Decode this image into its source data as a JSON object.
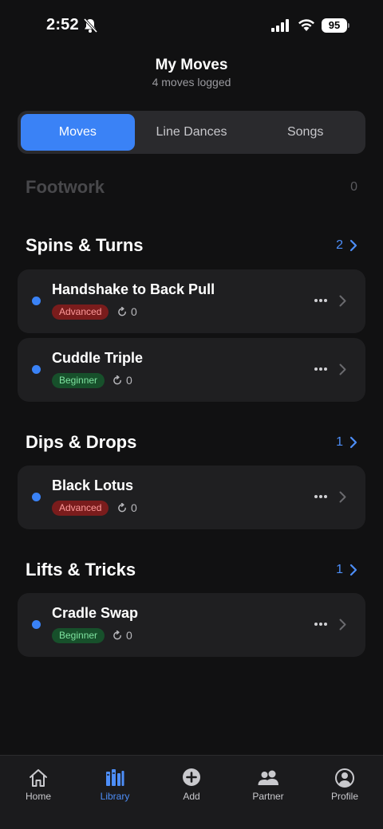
{
  "status_bar": {
    "time": "2:52",
    "battery": "95"
  },
  "header": {
    "title": "My Moves",
    "subtitle": "4 moves logged"
  },
  "segments": [
    {
      "label": "Moves",
      "active": true
    },
    {
      "label": "Line Dances",
      "active": false
    },
    {
      "label": "Songs",
      "active": false
    }
  ],
  "sections": [
    {
      "title": "Footwork",
      "count": "0",
      "dimmed": true,
      "moves": []
    },
    {
      "title": "Spins & Turns",
      "count": "2",
      "dimmed": false,
      "moves": [
        {
          "name": "Handshake to Back Pull",
          "level": "Advanced",
          "reps": "0"
        },
        {
          "name": "Cuddle Triple",
          "level": "Beginner",
          "reps": "0"
        }
      ]
    },
    {
      "title": "Dips & Drops",
      "count": "1",
      "dimmed": false,
      "moves": [
        {
          "name": "Black Lotus",
          "level": "Advanced",
          "reps": "0"
        }
      ]
    },
    {
      "title": "Lifts & Tricks",
      "count": "1",
      "dimmed": false,
      "moves": [
        {
          "name": "Cradle Swap",
          "level": "Beginner",
          "reps": "0"
        }
      ]
    }
  ],
  "tabs": [
    {
      "label": "Home",
      "icon": "home-icon",
      "active": false
    },
    {
      "label": "Library",
      "icon": "library-icon",
      "active": true
    },
    {
      "label": "Add",
      "icon": "add-icon",
      "active": false
    },
    {
      "label": "Partner",
      "icon": "partner-icon",
      "active": false
    },
    {
      "label": "Profile",
      "icon": "profile-icon",
      "active": false
    }
  ],
  "colors": {
    "accent": "#3a82f6",
    "background": "#111112",
    "card": "#1f1f21",
    "advanced": "#7a1c1c",
    "beginner": "#17502b"
  }
}
